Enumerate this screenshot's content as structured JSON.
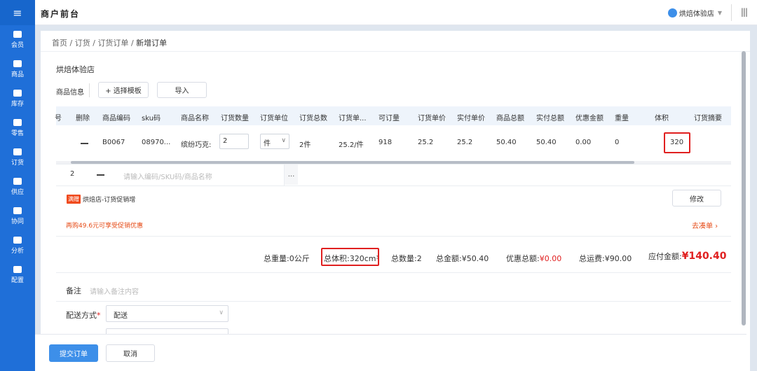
{
  "app": {
    "title": "商户前台",
    "store_selector": "烘焙体验店"
  },
  "sidebar": {
    "items": [
      {
        "label": "会员",
        "icon": "member-icon"
      },
      {
        "label": "商品",
        "icon": "goods-icon"
      },
      {
        "label": "库存",
        "icon": "inventory-icon"
      },
      {
        "label": "零售",
        "icon": "retail-icon"
      },
      {
        "label": "订货",
        "icon": "order-icon"
      },
      {
        "label": "供应",
        "icon": "supply-icon"
      },
      {
        "label": "协同",
        "icon": "collab-icon"
      },
      {
        "label": "分析",
        "icon": "analysis-icon"
      },
      {
        "label": "配置",
        "icon": "settings-icon"
      }
    ]
  },
  "breadcrumb": {
    "home": "首页",
    "order": "订货",
    "order_list": "订货订单",
    "current": "新增订单",
    "sep": "/"
  },
  "store_title": "烘焙体验店",
  "goods_section": {
    "label": "商品信息",
    "select_template": "+ 选择模板",
    "import": "导入"
  },
  "table": {
    "headers": [
      "号",
      "删除",
      "商品编码",
      "sku码",
      "商品名称",
      "订货数量",
      "订货单位",
      "订货总数",
      "订货单...",
      "可订量",
      "订货单价",
      "实付单价",
      "商品总额",
      "实付总额",
      "优惠金额",
      "重量",
      "体积",
      "订货摘要"
    ],
    "row": {
      "code": "B0067",
      "sku": "08970...",
      "name": "缤纷巧克:",
      "qty": "2",
      "unit": "件",
      "total": "2件",
      "order_unit_price": "25.2/件",
      "available": "918",
      "unit_price": "25.2",
      "paid_price": "25.2",
      "goods_total": "50.40",
      "paid_total": "50.40",
      "discount": "0.00",
      "weight": "0",
      "volume": "320"
    },
    "add_row": {
      "index": "2",
      "placeholder": "请输入编码/SKU码/商品名称",
      "more": "..."
    }
  },
  "promo": {
    "tag": "满赠",
    "name": "烘焙店-订货促销增",
    "edit_button": "修改",
    "tip": "再购49.6元可享受促销优惠",
    "link": "去凑单 ›"
  },
  "summary": {
    "weight": "总重量:0公斤",
    "volume": "总体积:320cm³",
    "count": "总数量:2",
    "amount_label": "总金额:",
    "amount": "¥50.40",
    "discount_label": "优惠总额:",
    "discount": "¥0.00",
    "freight_label": "总运费:",
    "freight": "¥90.00",
    "payable_label": "应付金额:",
    "payable": "¥140.40"
  },
  "remark": {
    "label": "备注",
    "placeholder": "请输入备注内容"
  },
  "delivery": {
    "label": "配送方式",
    "required": "*",
    "value": "配送"
  },
  "footer": {
    "submit": "提交订单",
    "cancel": "取消"
  },
  "colors": {
    "sidebar": "#1f6fd8",
    "primary": "#3d8fe9",
    "danger": "#e02020",
    "promo": "#e64b17"
  }
}
